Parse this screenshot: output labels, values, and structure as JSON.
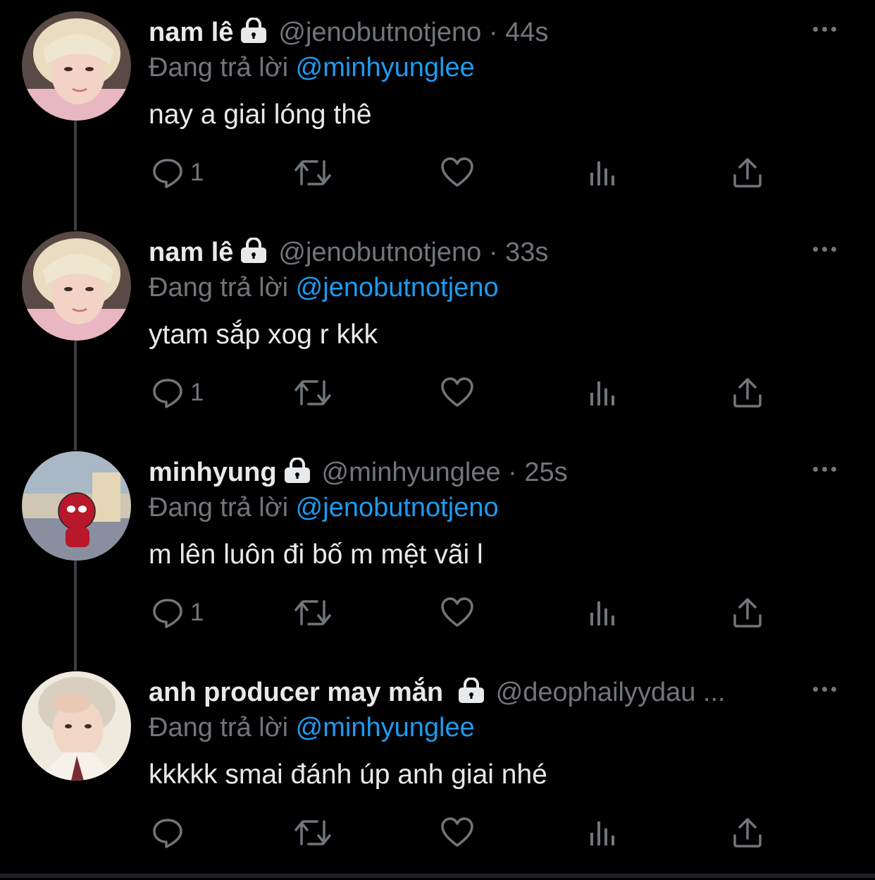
{
  "tweets": [
    {
      "name": "nam lê",
      "handle": "@jenobutnotjeno",
      "separator": "·",
      "time": "44s",
      "replying_prefix": "Đang trả lời",
      "replying_to": "@minhyunglee",
      "text": "nay a giai lóng thê",
      "reply_count": "1",
      "avatar_icon": "avatar-photo"
    },
    {
      "name": "nam lê",
      "handle": "@jenobutnotjeno",
      "separator": "·",
      "time": "33s",
      "replying_prefix": "Đang trả lời",
      "replying_to": "@jenobutnotjeno",
      "text": "ytam sắp xog r kkk",
      "reply_count": "1",
      "avatar_icon": "avatar-photo"
    },
    {
      "name": "minhyung",
      "handle": "@minhyunglee",
      "separator": "·",
      "time": "25s",
      "replying_prefix": "Đang trả lời",
      "replying_to": "@jenobutnotjeno",
      "text": "m lên luôn đi bố m mệt vãi l",
      "reply_count": "1",
      "avatar_icon": "avatar-photo"
    },
    {
      "name": "anh producer may mắn",
      "handle": "@deophailyydau ...",
      "separator": "",
      "time": "",
      "replying_prefix": "Đang trả lời",
      "replying_to": "@minhyunglee",
      "text": "kkkkk smai đánh úp anh giai nhé",
      "reply_count": "",
      "avatar_icon": "avatar-photo"
    }
  ],
  "icons": {
    "reply": "reply-icon",
    "retweet": "retweet-icon",
    "like": "heart-icon",
    "views": "views-icon",
    "share": "share-icon",
    "more": "more-icon",
    "lock": "lock-icon"
  },
  "colors": {
    "background": "#000000",
    "text": "#e7e9ea",
    "secondary": "#71767b",
    "mention": "#1d9bf0",
    "thread_line": "#3c3f44"
  }
}
